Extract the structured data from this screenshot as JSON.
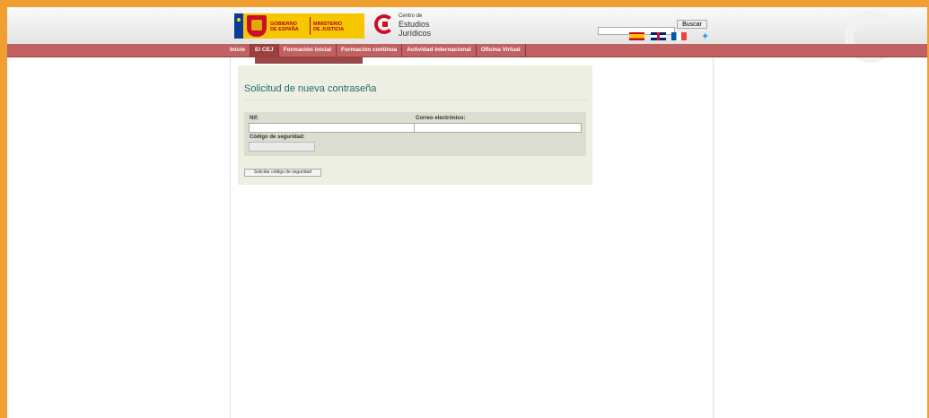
{
  "header": {
    "gov_line1": "GOBIERNO",
    "gov_line2": "DE ESPAÑA",
    "ministry_line1": "MINISTERIO",
    "ministry_line2": "DE JUSTICIA",
    "cej_line1": "Centro de",
    "cej_line2": "Estudios",
    "cej_line3": "Jurídicos"
  },
  "search": {
    "value": "",
    "button_label": "Buscar"
  },
  "languages": [
    "Español",
    "English",
    "Français"
  ],
  "nav": {
    "items": [
      {
        "label": "Inicio"
      },
      {
        "label": "El CEJ"
      },
      {
        "label": "Formación inicial"
      },
      {
        "label": "Formación continua"
      },
      {
        "label": "Actividad internacional"
      },
      {
        "label": "Oficina Virtual"
      }
    ]
  },
  "form": {
    "title": "Solicitud de nueva contraseña",
    "nif_label": "Nif:",
    "nif_value": "",
    "email_label": "Correo electrónico:",
    "email_value": "",
    "security_label": "Código de seguridad:",
    "security_value": "",
    "submit_label": "Solicitar código de seguridad"
  },
  "colors": {
    "frame": "#f0a030",
    "nav": "#c06262",
    "title": "#246b66",
    "card": "#edefe3"
  }
}
